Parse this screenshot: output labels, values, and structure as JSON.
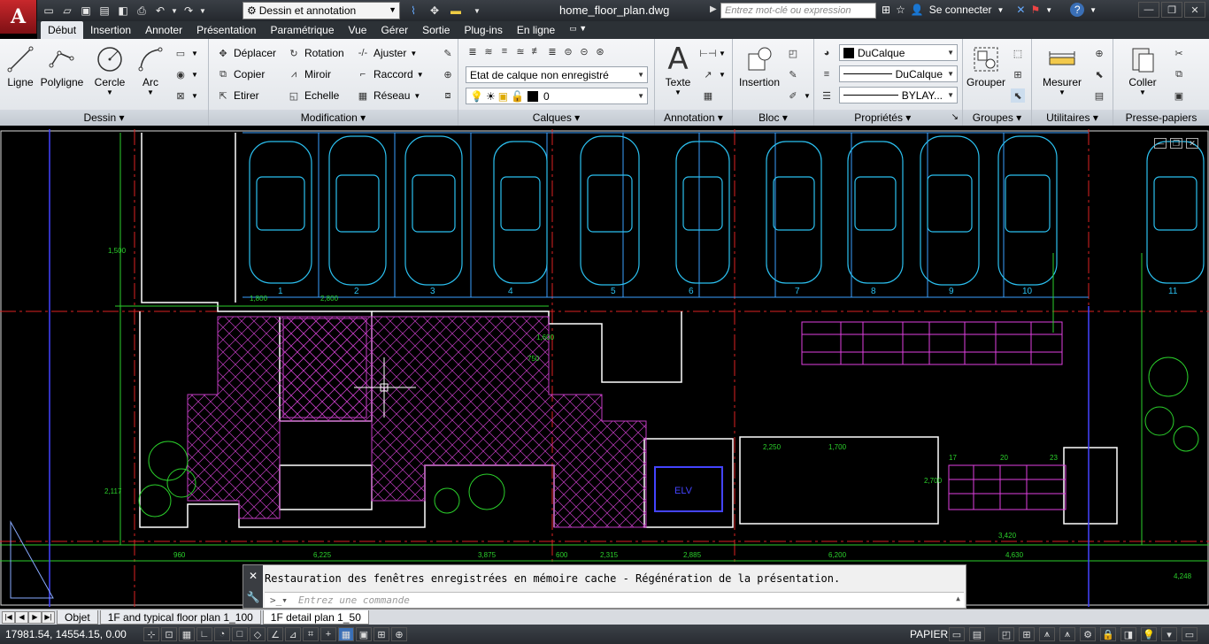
{
  "app": {
    "logo": "A",
    "doc_title": "home_floor_plan.dwg"
  },
  "workspace": {
    "selected": "Dessin et annotation"
  },
  "search": {
    "placeholder": "Entrez mot-clé ou expression"
  },
  "user": {
    "signin": "Se connecter"
  },
  "ribbon_tabs": [
    "Début",
    "Insertion",
    "Annoter",
    "Présentation",
    "Paramétrique",
    "Vue",
    "Gérer",
    "Sortie",
    "Plug-ins",
    "En ligne"
  ],
  "panels": {
    "dessin": {
      "title": "Dessin",
      "ligne": "Ligne",
      "polyligne": "Polyligne",
      "cercle": "Cercle",
      "arc": "Arc"
    },
    "modification": {
      "title": "Modification",
      "deplacer": "Déplacer",
      "rotation": "Rotation",
      "ajuster": "Ajuster",
      "copier": "Copier",
      "miroir": "Miroir",
      "raccord": "Raccord",
      "etirer": "Etirer",
      "echelle": "Echelle",
      "reseau": "Réseau"
    },
    "calques": {
      "title": "Calques",
      "state": "Etat de calque non enregistré",
      "current": "0"
    },
    "annotation": {
      "title": "Annotation",
      "texte": "Texte"
    },
    "bloc": {
      "title": "Bloc",
      "insertion": "Insertion"
    },
    "proprietes": {
      "title": "Propriétés",
      "color": "DuCalque",
      "linetype": "DuCalque",
      "lineweight": "BYLAY..."
    },
    "groupes": {
      "title": "Groupes",
      "grouper": "Grouper"
    },
    "utilitaires": {
      "title": "Utilitaires",
      "mesurer": "Mesurer"
    },
    "presse": {
      "title": "Presse-papiers",
      "coller": "Coller"
    }
  },
  "drawing": {
    "parking_numbers": [
      "1",
      "2",
      "3",
      "4",
      "5",
      "6",
      "7",
      "8",
      "9",
      "10",
      "11"
    ],
    "labels": {
      "elv": "ELV",
      "dim1": "6,225",
      "dim2": "3,875",
      "dim3": "600",
      "dim4": "2,315",
      "dim5": "2,885",
      "dim6": "6,200",
      "dim7": "4,630",
      "dim8": "4,248",
      "dim9": "3,420",
      "dim10": "2,250",
      "dim11": "1,700",
      "dim12": "1,600",
      "dim13": "2,700",
      "dim14": "960",
      "dim15": "2,800",
      "dim16": "1,800",
      "dim17": "750",
      "dim18": "1,500",
      "dim19": "2,117",
      "dim20": "17",
      "dim21": "20",
      "dim22": "23"
    }
  },
  "command": {
    "history": "Restauration des fenêtres enregistrées en mémoire cache - Régénération de la présentation.",
    "placeholder": "Entrez une commande"
  },
  "layout_tabs": [
    "Objet",
    "1F and typical floor plan 1_100",
    "1F detail plan 1_50"
  ],
  "status": {
    "coords": "17981.54, 14554.15, 0.00",
    "space": "PAPIER"
  }
}
